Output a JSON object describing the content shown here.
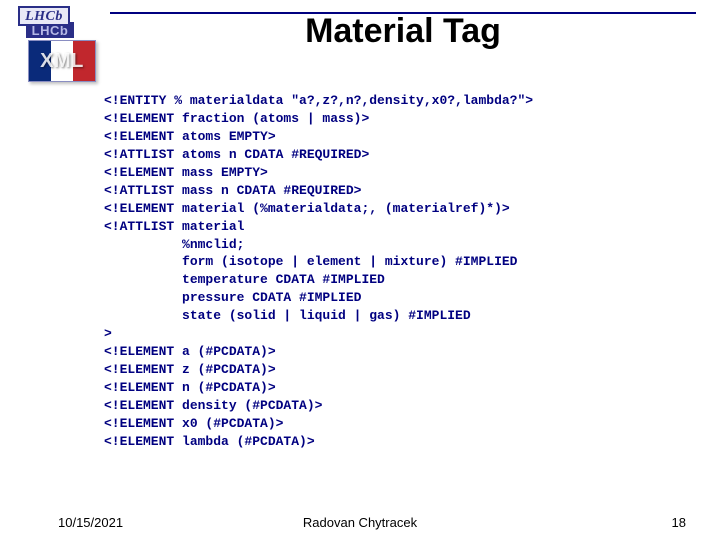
{
  "logo": {
    "brand_top": "LHCb",
    "brand_shadow": "LHCb",
    "xml_label": "XML"
  },
  "title": "Material Tag",
  "code": "<!ENTITY % materialdata \"a?,z?,n?,density,x0?,lambda?\">\n<!ELEMENT fraction (atoms | mass)>\n<!ELEMENT atoms EMPTY>\n<!ATTLIST atoms n CDATA #REQUIRED>\n<!ELEMENT mass EMPTY>\n<!ATTLIST mass n CDATA #REQUIRED>\n<!ELEMENT material (%materialdata;, (materialref)*)>\n<!ATTLIST material\n          %nmclid;\n          form (isotope | element | mixture) #IMPLIED\n          temperature CDATA #IMPLIED\n          pressure CDATA #IMPLIED\n          state (solid | liquid | gas) #IMPLIED\n>\n<!ELEMENT a (#PCDATA)>\n<!ELEMENT z (#PCDATA)>\n<!ELEMENT n (#PCDATA)>\n<!ELEMENT density (#PCDATA)>\n<!ELEMENT x0 (#PCDATA)>\n<!ELEMENT lambda (#PCDATA)>",
  "footer": {
    "date": "10/15/2021",
    "author": "Radovan Chytracek",
    "page": "18"
  }
}
